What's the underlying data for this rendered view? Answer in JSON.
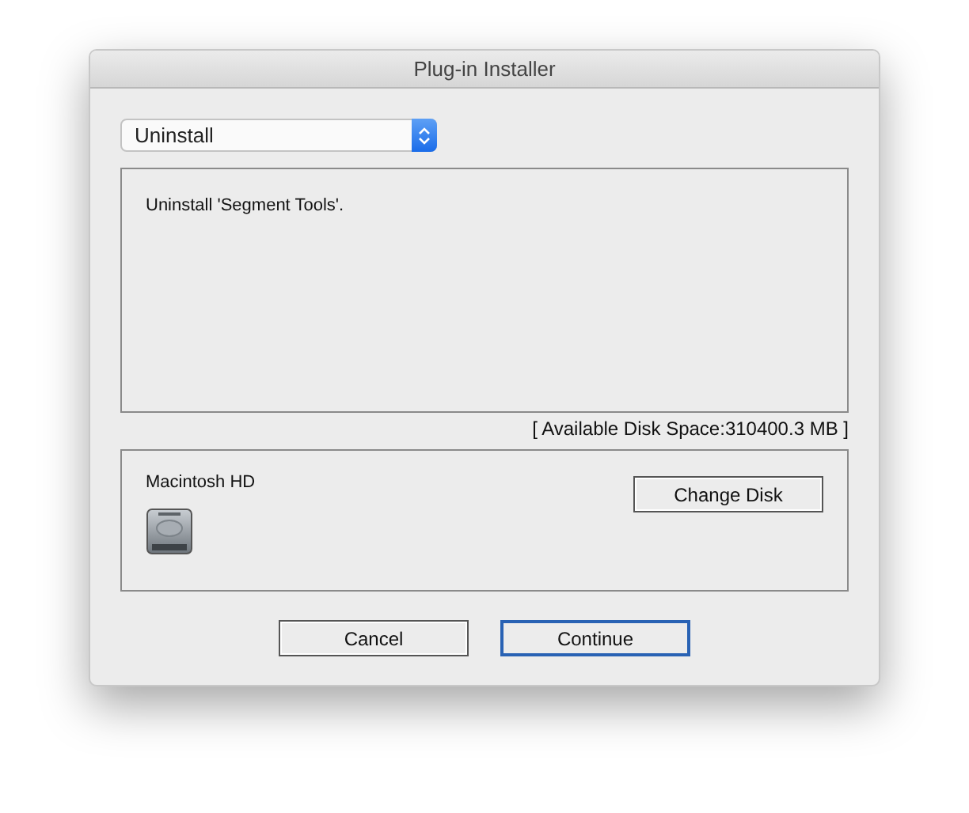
{
  "window": {
    "title": "Plug-in Installer"
  },
  "action_popup": {
    "value": "Uninstall"
  },
  "message": "Uninstall 'Segment Tools'.",
  "disk_space": "[ Available Disk Space:310400.3 MB ]",
  "disk": {
    "name": "Macintosh HD",
    "button": "Change Disk"
  },
  "buttons": [
    {
      "label": "Cancel",
      "default": false
    },
    {
      "label": "Continue",
      "default": true
    }
  ]
}
